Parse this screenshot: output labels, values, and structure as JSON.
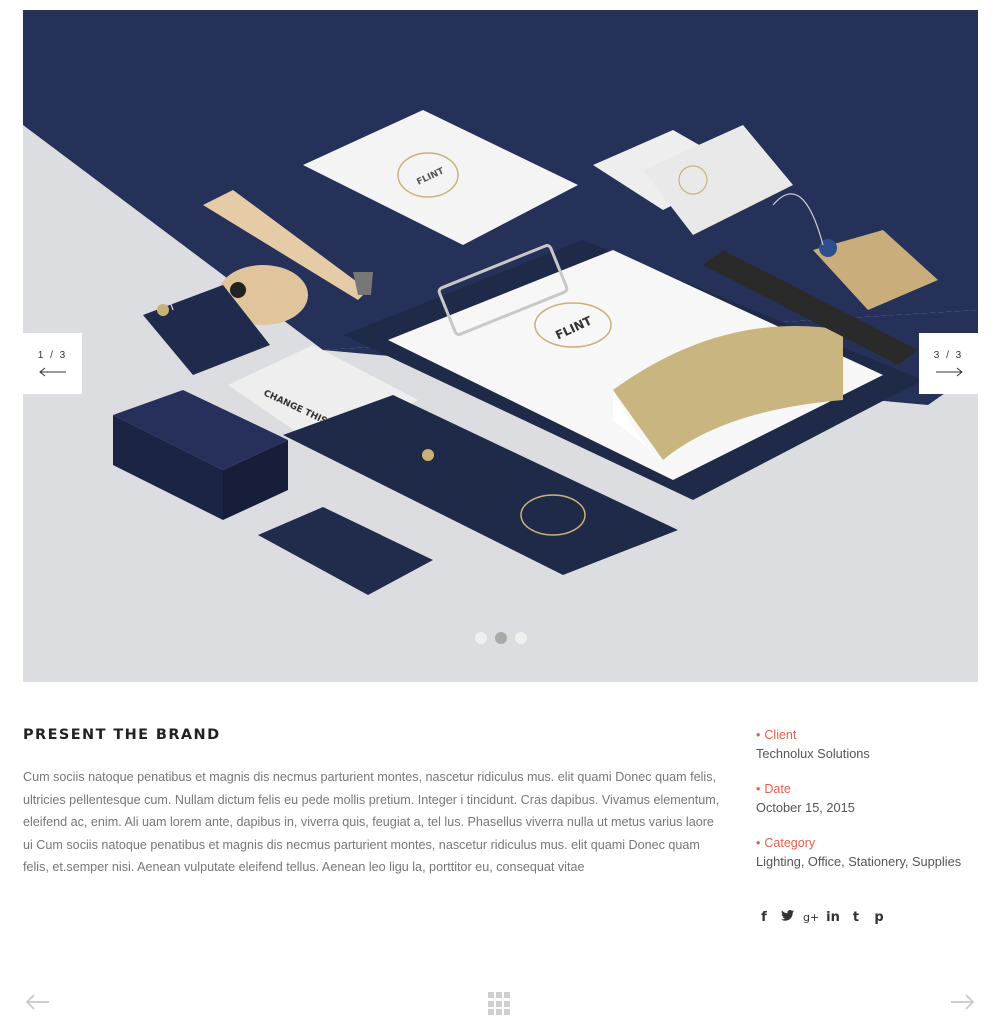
{
  "slider": {
    "prev_count": "1 / 3",
    "next_count": "3 / 3",
    "dots": [
      {
        "active": false
      },
      {
        "active": true
      },
      {
        "active": false
      }
    ],
    "mockup_brand": "FLINT",
    "mockup_text": "CHANGE THIS TEXT"
  },
  "project": {
    "title": "PRESENT THE BRAND",
    "description": "Cum sociis natoque penatibus et magnis dis necmus parturient montes, nascetur ridiculus mus. elit quami Donec quam felis, ultricies pellentesque cum. Nullam dictum felis eu pede mollis pretium. Integer i tincidunt. Cras dapibus. Vivamus elementum, eleifend ac, enim. Ali uam lorem ante, dapibus in, viverra quis, feugiat a, tel lus. Phasellus viverra nulla ut metus varius laore ui Cum sociis natoque penatibus et magnis dis necmus parturient montes, nascetur ridiculus mus. elit quami Donec quam felis, et.semper nisi. Aenean vulputate eleifend tellus. Aenean leo ligu la, porttitor eu, consequat vitae"
  },
  "meta": {
    "client_label": "Client",
    "client_value": "Technolux Solutions",
    "date_label": "Date",
    "date_value": "October 15, 2015",
    "category_label": "Category",
    "category_value": "Lighting, Office, Stationery, Supplies"
  },
  "social": {
    "facebook": "f",
    "twitter": "❝",
    "googleplus": "g+",
    "linkedin": "in",
    "tumblr": "t",
    "pinterest": "p"
  },
  "colors": {
    "accent": "#e8604c",
    "navy": "#1f2a48",
    "paper": "#d9dadd",
    "gold": "#c9b27a"
  },
  "icons": [
    "arrow-left-icon",
    "arrow-right-icon",
    "facebook-icon",
    "twitter-icon",
    "google-plus-icon",
    "linkedin-icon",
    "tumblr-icon",
    "pinterest-icon",
    "grid-icon"
  ]
}
